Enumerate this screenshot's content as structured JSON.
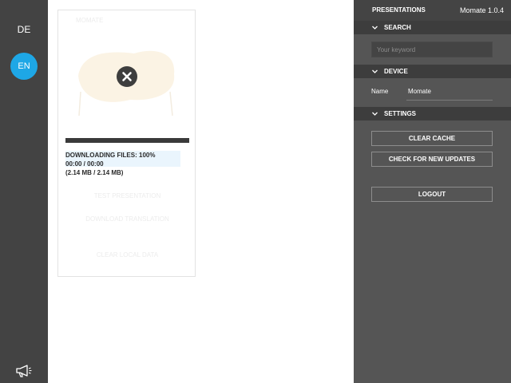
{
  "languages": {
    "de": "DE",
    "en": "EN",
    "active": "EN",
    "active_color": "#1ea7e6"
  },
  "sidebar_icons": [
    "megaphone-icon"
  ],
  "presentation_card": {
    "faint_title": "MOMATE",
    "close_icon": "close-icon",
    "download": {
      "progress": 1.0,
      "status": "DOWNLOADING FILES: 100%",
      "time": "00:00 / 00:00",
      "size": "(2.14 MB / 2.14 MB)"
    },
    "ghost_actions": [
      "TEST PRESENTATION",
      "DOWNLOAD TRANSLATION",
      "CLEAR LOCAL DATA"
    ]
  },
  "panel": {
    "title": "PRESENTATIONS",
    "version": "Momate 1.0.4",
    "search": {
      "label": "SEARCH",
      "placeholder": "Your keyword",
      "value": ""
    },
    "device": {
      "label": "DEVICE",
      "name_label": "Name",
      "name_value": "Momate"
    },
    "settings": {
      "label": "SETTINGS",
      "clear_cache": "CLEAR CACHE",
      "check_updates": "CHECK FOR NEW UPDATES",
      "logout": "LOGOUT"
    }
  }
}
